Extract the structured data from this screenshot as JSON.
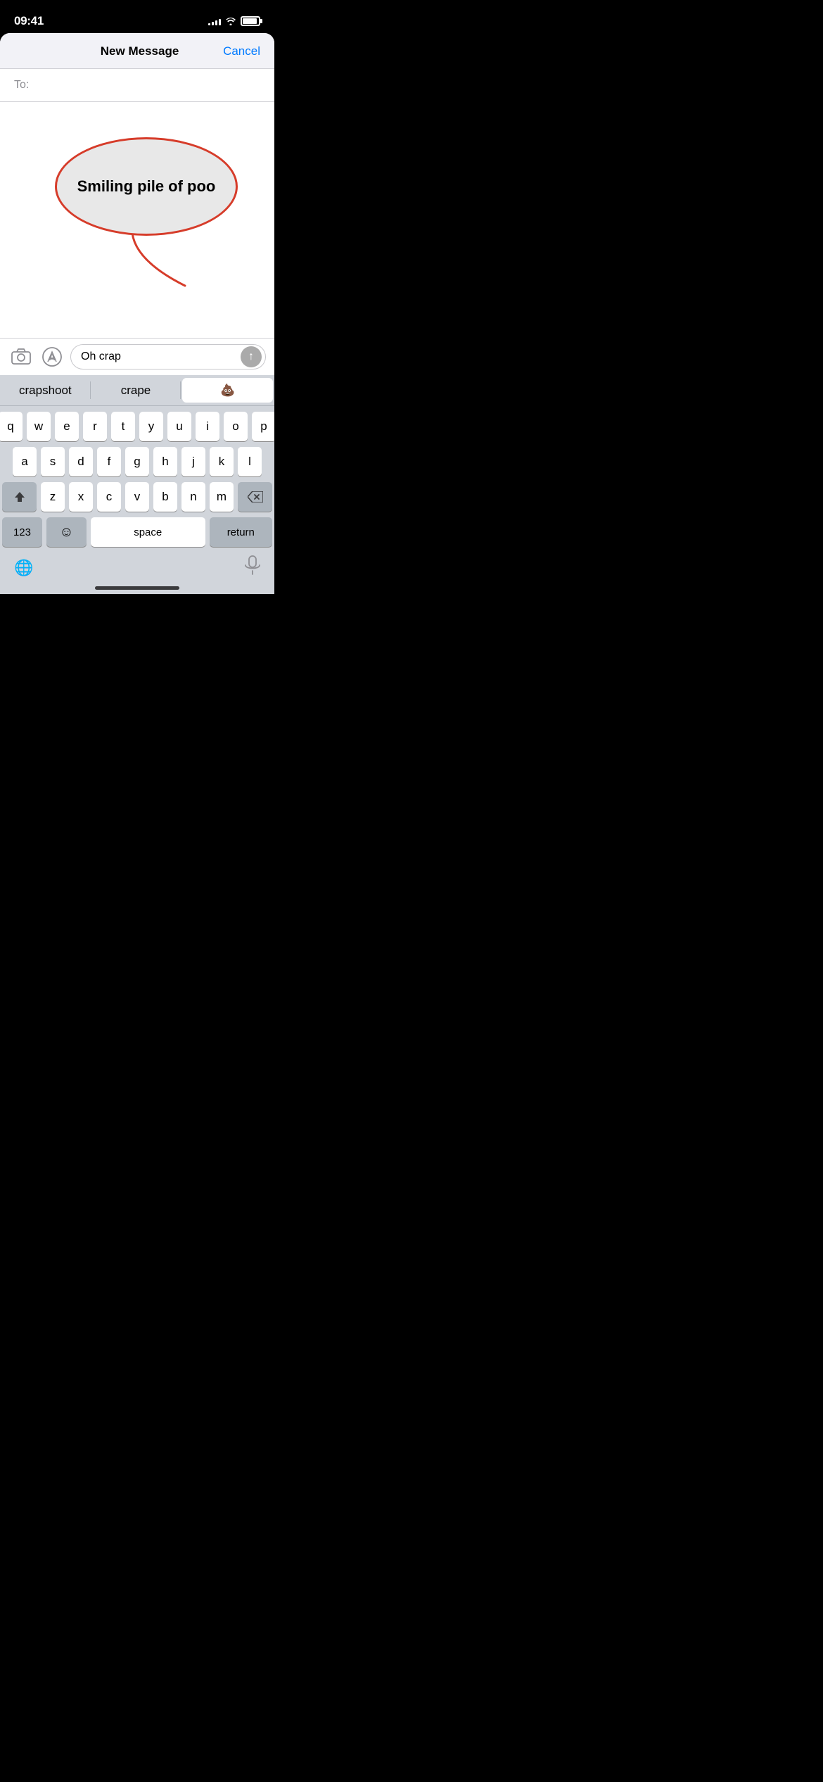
{
  "status_bar": {
    "time": "09:41",
    "signal_bars": [
      3,
      5,
      7,
      9,
      11
    ],
    "battery_level": 90
  },
  "nav": {
    "title": "New Message",
    "cancel_label": "Cancel"
  },
  "to_field": {
    "label": "To:",
    "placeholder": ""
  },
  "tooltip": {
    "text": "Smiling pile of poo"
  },
  "input_bar": {
    "message_text": "Oh crap"
  },
  "autocomplete": {
    "items": [
      "crapshoot",
      "crape",
      "💩"
    ]
  },
  "keyboard": {
    "row1": [
      "q",
      "w",
      "e",
      "r",
      "t",
      "y",
      "u",
      "i",
      "o",
      "p"
    ],
    "row2": [
      "a",
      "s",
      "d",
      "f",
      "g",
      "h",
      "j",
      "k",
      "l"
    ],
    "row3": [
      "z",
      "x",
      "c",
      "v",
      "b",
      "n",
      "m"
    ],
    "bottom": {
      "numbers": "123",
      "emoji": "☺",
      "space": "space",
      "return": "return"
    }
  },
  "icons": {
    "camera": "📷",
    "appstore": "🅐",
    "globe": "🌐",
    "mic": "🎤",
    "send_arrow": "↑",
    "shift": "⇧",
    "delete": "⌫"
  }
}
